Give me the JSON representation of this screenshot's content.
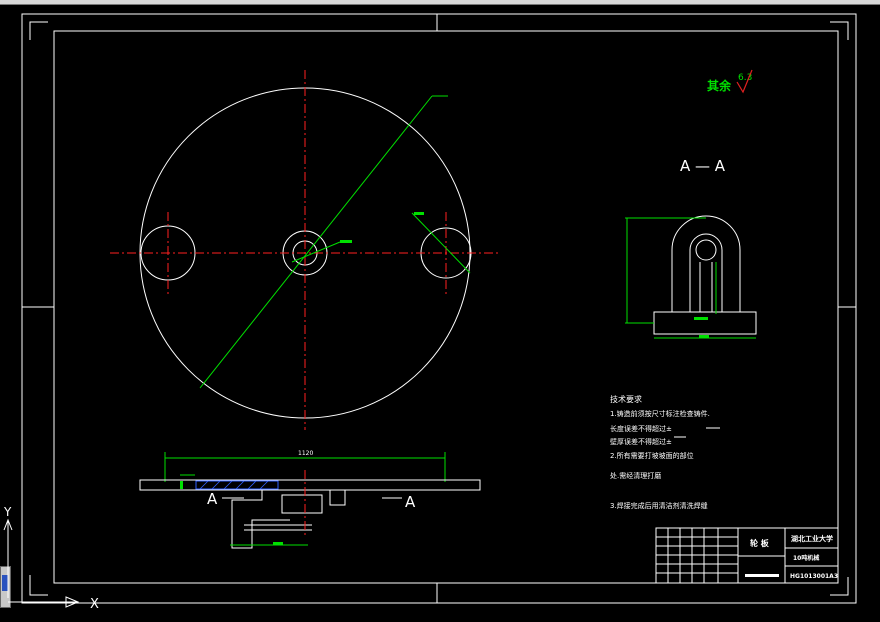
{
  "drawing": {
    "roughness_label": "其余",
    "roughness_value": "6.3",
    "section_label_main": "A — A",
    "section_mark_left": "A",
    "section_mark_right": "A",
    "dim_width_bottom": "1120",
    "tech_requirements": {
      "title": "技术要求",
      "lines": [
        "1.铸造前须按尺寸标注检查铸件.",
        "长度误差不得超过±",
        "壁厚误差不得超过±",
        "2.所有需要打坡坡面的部位",
        "处.需经清理打磨",
        "3.焊接完成后用清洁剂清洗焊缝"
      ]
    },
    "title_block": {
      "part_name": "轮 板",
      "school": "湖北工业大学",
      "project": "10吨机械",
      "drawing_no": "HG1013001A3"
    }
  },
  "ui": {
    "axis_y": "Y",
    "axis_x": "X"
  },
  "colors": {
    "background": "#000000",
    "outline": "#ffffff",
    "centerline": "#ff2020",
    "dimension": "#00e000",
    "hatch": "#3060ff"
  }
}
